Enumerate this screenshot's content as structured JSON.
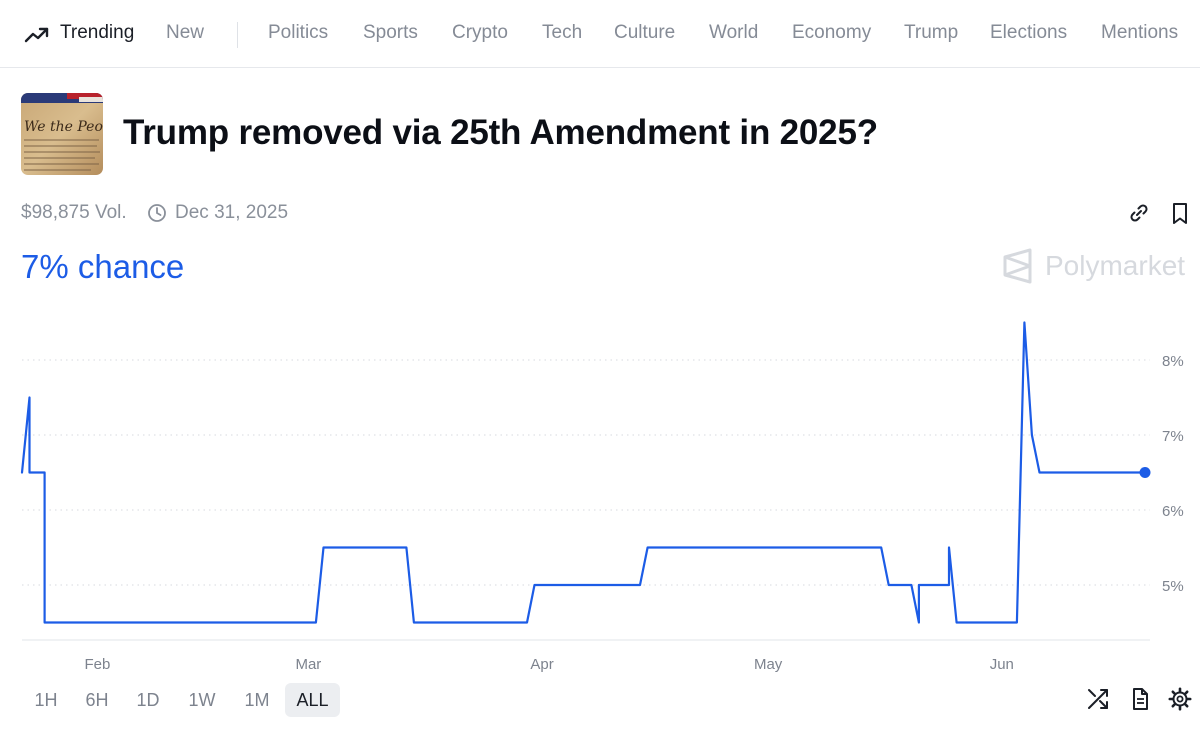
{
  "nav": {
    "items": [
      {
        "label": "Trending",
        "active": true
      },
      {
        "label": "New"
      },
      {
        "label": "Politics"
      },
      {
        "label": "Sports"
      },
      {
        "label": "Crypto"
      },
      {
        "label": "Tech"
      },
      {
        "label": "Culture"
      },
      {
        "label": "World"
      },
      {
        "label": "Economy"
      },
      {
        "label": "Trump"
      },
      {
        "label": "Elections"
      },
      {
        "label": "Mentions"
      }
    ],
    "trending_icon": "trending-up-icon"
  },
  "market": {
    "title": "Trump removed via 25th Amendment in 2025?",
    "volume": "$98,875 Vol.",
    "end_date": "Dec 31, 2025",
    "chance": "7% chance",
    "brand": "Polymarket",
    "accent_color": "#1c5ce6"
  },
  "icons": {
    "date": "clock-icon",
    "share": "link-icon",
    "save": "bookmark-icon",
    "brand": "polymarket-logo-icon",
    "swap": "shuffle-icon",
    "rules": "document-icon",
    "settings": "gear-icon"
  },
  "range": {
    "options": [
      "1H",
      "6H",
      "1D",
      "1W",
      "1M",
      "ALL"
    ],
    "selected": "ALL"
  },
  "chart_data": {
    "type": "line",
    "color": "#1c5ce6",
    "x_unit": "date (2025)",
    "x_ticks": [
      "Feb",
      "Mar",
      "Apr",
      "May",
      "Jun"
    ],
    "y_ticks": [
      "5%",
      "6%",
      "7%",
      "8%"
    ],
    "y_tick_values": [
      5,
      6,
      7,
      8
    ],
    "ylim": [
      4.3,
      8.6
    ],
    "grid": "horizontal dotted",
    "x": [
      "2025-01-22",
      "2025-01-23",
      "2025-01-23",
      "2025-01-24",
      "2025-01-25",
      "2025-01-25",
      "2025-01-26",
      "2025-03-02",
      "2025-03-03",
      "2025-03-14",
      "2025-03-15",
      "2025-03-30",
      "2025-03-31",
      "2025-04-14",
      "2025-04-15",
      "2025-05-16",
      "2025-05-17",
      "2025-05-20",
      "2025-05-21",
      "2025-05-21",
      "2025-05-25",
      "2025-05-25",
      "2025-05-26",
      "2025-06-03",
      "2025-06-04",
      "2025-06-05",
      "2025-06-06",
      "2025-06-20"
    ],
    "y": [
      6.5,
      7.5,
      6.5,
      6.5,
      6.5,
      4.5,
      4.5,
      4.5,
      5.5,
      5.5,
      4.5,
      4.5,
      5.0,
      5.0,
      5.5,
      5.5,
      5.0,
      5.0,
      4.5,
      5.0,
      5.0,
      5.5,
      4.5,
      4.5,
      8.5,
      7.0,
      6.5,
      6.5
    ],
    "last_value": 6.5
  }
}
